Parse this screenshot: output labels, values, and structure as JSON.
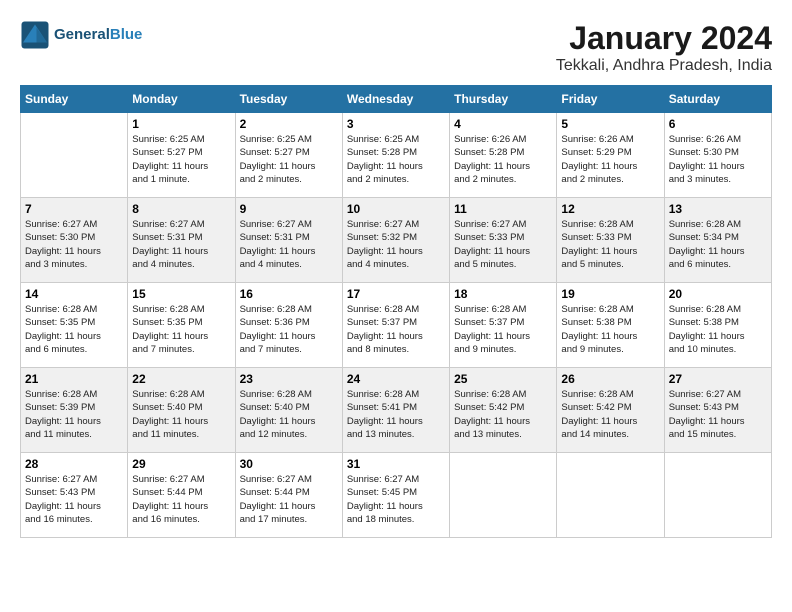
{
  "header": {
    "logo_line1": "General",
    "logo_line2": "Blue",
    "month_title": "January 2024",
    "location": "Tekkali, Andhra Pradesh, India"
  },
  "days_of_week": [
    "Sunday",
    "Monday",
    "Tuesday",
    "Wednesday",
    "Thursday",
    "Friday",
    "Saturday"
  ],
  "weeks": [
    [
      {
        "day": "",
        "info": ""
      },
      {
        "day": "1",
        "info": "Sunrise: 6:25 AM\nSunset: 5:27 PM\nDaylight: 11 hours\nand 1 minute."
      },
      {
        "day": "2",
        "info": "Sunrise: 6:25 AM\nSunset: 5:27 PM\nDaylight: 11 hours\nand 2 minutes."
      },
      {
        "day": "3",
        "info": "Sunrise: 6:25 AM\nSunset: 5:28 PM\nDaylight: 11 hours\nand 2 minutes."
      },
      {
        "day": "4",
        "info": "Sunrise: 6:26 AM\nSunset: 5:28 PM\nDaylight: 11 hours\nand 2 minutes."
      },
      {
        "day": "5",
        "info": "Sunrise: 6:26 AM\nSunset: 5:29 PM\nDaylight: 11 hours\nand 2 minutes."
      },
      {
        "day": "6",
        "info": "Sunrise: 6:26 AM\nSunset: 5:30 PM\nDaylight: 11 hours\nand 3 minutes."
      }
    ],
    [
      {
        "day": "7",
        "info": "Sunrise: 6:27 AM\nSunset: 5:30 PM\nDaylight: 11 hours\nand 3 minutes."
      },
      {
        "day": "8",
        "info": "Sunrise: 6:27 AM\nSunset: 5:31 PM\nDaylight: 11 hours\nand 4 minutes."
      },
      {
        "day": "9",
        "info": "Sunrise: 6:27 AM\nSunset: 5:31 PM\nDaylight: 11 hours\nand 4 minutes."
      },
      {
        "day": "10",
        "info": "Sunrise: 6:27 AM\nSunset: 5:32 PM\nDaylight: 11 hours\nand 4 minutes."
      },
      {
        "day": "11",
        "info": "Sunrise: 6:27 AM\nSunset: 5:33 PM\nDaylight: 11 hours\nand 5 minutes."
      },
      {
        "day": "12",
        "info": "Sunrise: 6:28 AM\nSunset: 5:33 PM\nDaylight: 11 hours\nand 5 minutes."
      },
      {
        "day": "13",
        "info": "Sunrise: 6:28 AM\nSunset: 5:34 PM\nDaylight: 11 hours\nand 6 minutes."
      }
    ],
    [
      {
        "day": "14",
        "info": "Sunrise: 6:28 AM\nSunset: 5:35 PM\nDaylight: 11 hours\nand 6 minutes."
      },
      {
        "day": "15",
        "info": "Sunrise: 6:28 AM\nSunset: 5:35 PM\nDaylight: 11 hours\nand 7 minutes."
      },
      {
        "day": "16",
        "info": "Sunrise: 6:28 AM\nSunset: 5:36 PM\nDaylight: 11 hours\nand 7 minutes."
      },
      {
        "day": "17",
        "info": "Sunrise: 6:28 AM\nSunset: 5:37 PM\nDaylight: 11 hours\nand 8 minutes."
      },
      {
        "day": "18",
        "info": "Sunrise: 6:28 AM\nSunset: 5:37 PM\nDaylight: 11 hours\nand 9 minutes."
      },
      {
        "day": "19",
        "info": "Sunrise: 6:28 AM\nSunset: 5:38 PM\nDaylight: 11 hours\nand 9 minutes."
      },
      {
        "day": "20",
        "info": "Sunrise: 6:28 AM\nSunset: 5:38 PM\nDaylight: 11 hours\nand 10 minutes."
      }
    ],
    [
      {
        "day": "21",
        "info": "Sunrise: 6:28 AM\nSunset: 5:39 PM\nDaylight: 11 hours\nand 11 minutes."
      },
      {
        "day": "22",
        "info": "Sunrise: 6:28 AM\nSunset: 5:40 PM\nDaylight: 11 hours\nand 11 minutes."
      },
      {
        "day": "23",
        "info": "Sunrise: 6:28 AM\nSunset: 5:40 PM\nDaylight: 11 hours\nand 12 minutes."
      },
      {
        "day": "24",
        "info": "Sunrise: 6:28 AM\nSunset: 5:41 PM\nDaylight: 11 hours\nand 13 minutes."
      },
      {
        "day": "25",
        "info": "Sunrise: 6:28 AM\nSunset: 5:42 PM\nDaylight: 11 hours\nand 13 minutes."
      },
      {
        "day": "26",
        "info": "Sunrise: 6:28 AM\nSunset: 5:42 PM\nDaylight: 11 hours\nand 14 minutes."
      },
      {
        "day": "27",
        "info": "Sunrise: 6:27 AM\nSunset: 5:43 PM\nDaylight: 11 hours\nand 15 minutes."
      }
    ],
    [
      {
        "day": "28",
        "info": "Sunrise: 6:27 AM\nSunset: 5:43 PM\nDaylight: 11 hours\nand 16 minutes."
      },
      {
        "day": "29",
        "info": "Sunrise: 6:27 AM\nSunset: 5:44 PM\nDaylight: 11 hours\nand 16 minutes."
      },
      {
        "day": "30",
        "info": "Sunrise: 6:27 AM\nSunset: 5:44 PM\nDaylight: 11 hours\nand 17 minutes."
      },
      {
        "day": "31",
        "info": "Sunrise: 6:27 AM\nSunset: 5:45 PM\nDaylight: 11 hours\nand 18 minutes."
      },
      {
        "day": "",
        "info": ""
      },
      {
        "day": "",
        "info": ""
      },
      {
        "day": "",
        "info": ""
      }
    ]
  ]
}
